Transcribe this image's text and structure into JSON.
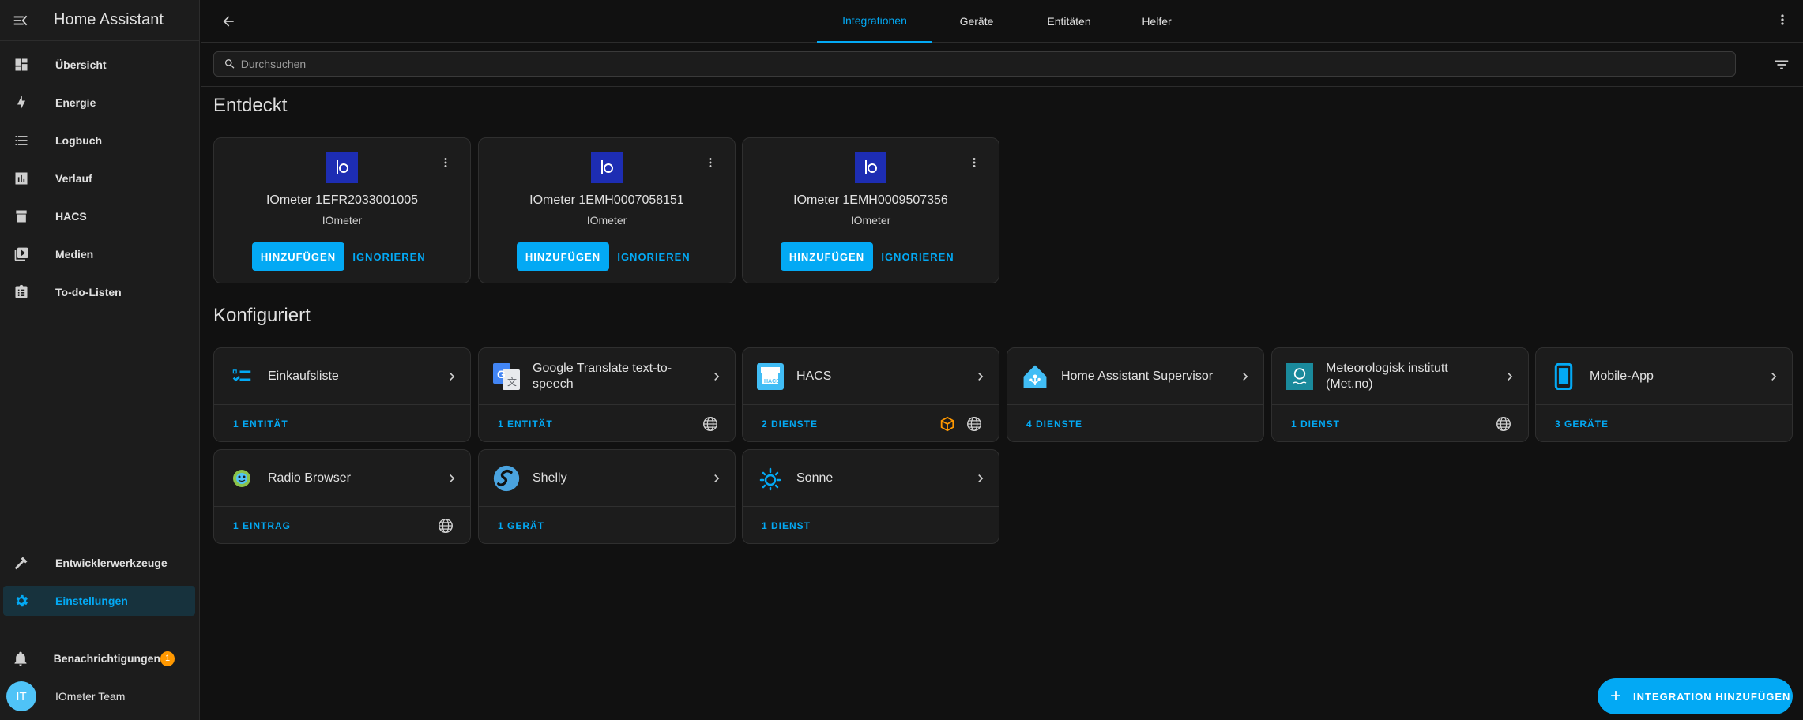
{
  "app": {
    "title": "Home Assistant"
  },
  "sidebar": {
    "items": [
      {
        "label": "Übersicht",
        "icon": "dashboard-icon"
      },
      {
        "label": "Energie",
        "icon": "lightning-icon"
      },
      {
        "label": "Logbuch",
        "icon": "list-icon"
      },
      {
        "label": "Verlauf",
        "icon": "chart-icon"
      },
      {
        "label": "HACS",
        "icon": "hacs-icon"
      },
      {
        "label": "Medien",
        "icon": "media-icon"
      },
      {
        "label": "To-do-Listen",
        "icon": "clipboard-icon"
      }
    ],
    "bottom": [
      {
        "label": "Entwicklerwerkzeuge",
        "icon": "hammer-icon"
      },
      {
        "label": "Einstellungen",
        "icon": "gear-icon"
      }
    ],
    "notifications": {
      "label": "Benachrichtigungen",
      "count": "1"
    },
    "user": {
      "name": "IOmeter Team",
      "initials": "IT"
    }
  },
  "tabs": [
    "Integrationen",
    "Geräte",
    "Entitäten",
    "Helfer"
  ],
  "search": {
    "placeholder": "Durchsuchen"
  },
  "discovered": {
    "title": "Entdeckt",
    "cards": [
      {
        "name": "IOmeter 1EFR2033001005",
        "sub": "IOmeter",
        "add": "HINZUFÜGEN",
        "ignore": "IGNORIEREN"
      },
      {
        "name": "IOmeter 1EMH0007058151",
        "sub": "IOmeter",
        "add": "HINZUFÜGEN",
        "ignore": "IGNORIEREN"
      },
      {
        "name": "IOmeter 1EMH0009507356",
        "sub": "IOmeter",
        "add": "HINZUFÜGEN",
        "ignore": "IGNORIEREN"
      }
    ]
  },
  "configured": {
    "title": "Konfiguriert",
    "cards": [
      {
        "name": "Einkaufsliste",
        "link": "1 ENTITÄT",
        "logo": "shopping-list-icon"
      },
      {
        "name": "Google Translate text-to-speech",
        "link": "1 ENTITÄT",
        "logo": "google-translate-icon"
      },
      {
        "name": "HACS",
        "link": "2 DIENSTE",
        "logo": "hacs-icon"
      },
      {
        "name": "Home Assistant Supervisor",
        "link": "4 DIENSTE",
        "logo": "home-assistant-icon"
      },
      {
        "name": "Meteorologisk institutt (Met.no)",
        "link": "1 DIENST",
        "logo": "met-no-icon"
      },
      {
        "name": "Mobile-App",
        "link": "3 GERÄTE",
        "logo": "phone-icon"
      },
      {
        "name": "Radio Browser",
        "link": "1 EINTRAG",
        "logo": "radio-browser-icon"
      },
      {
        "name": "Shelly",
        "link": "1 GERÄT",
        "logo": "shelly-icon"
      },
      {
        "name": "Sonne",
        "link": "1 DIENST",
        "logo": "sun-icon"
      }
    ]
  },
  "fab": {
    "label": "INTEGRATION HINZUFÜGEN"
  },
  "colors": {
    "accent": "#03a9f4",
    "background": "#111111",
    "card": "#1c1c1c",
    "badge": "#ff9800"
  }
}
